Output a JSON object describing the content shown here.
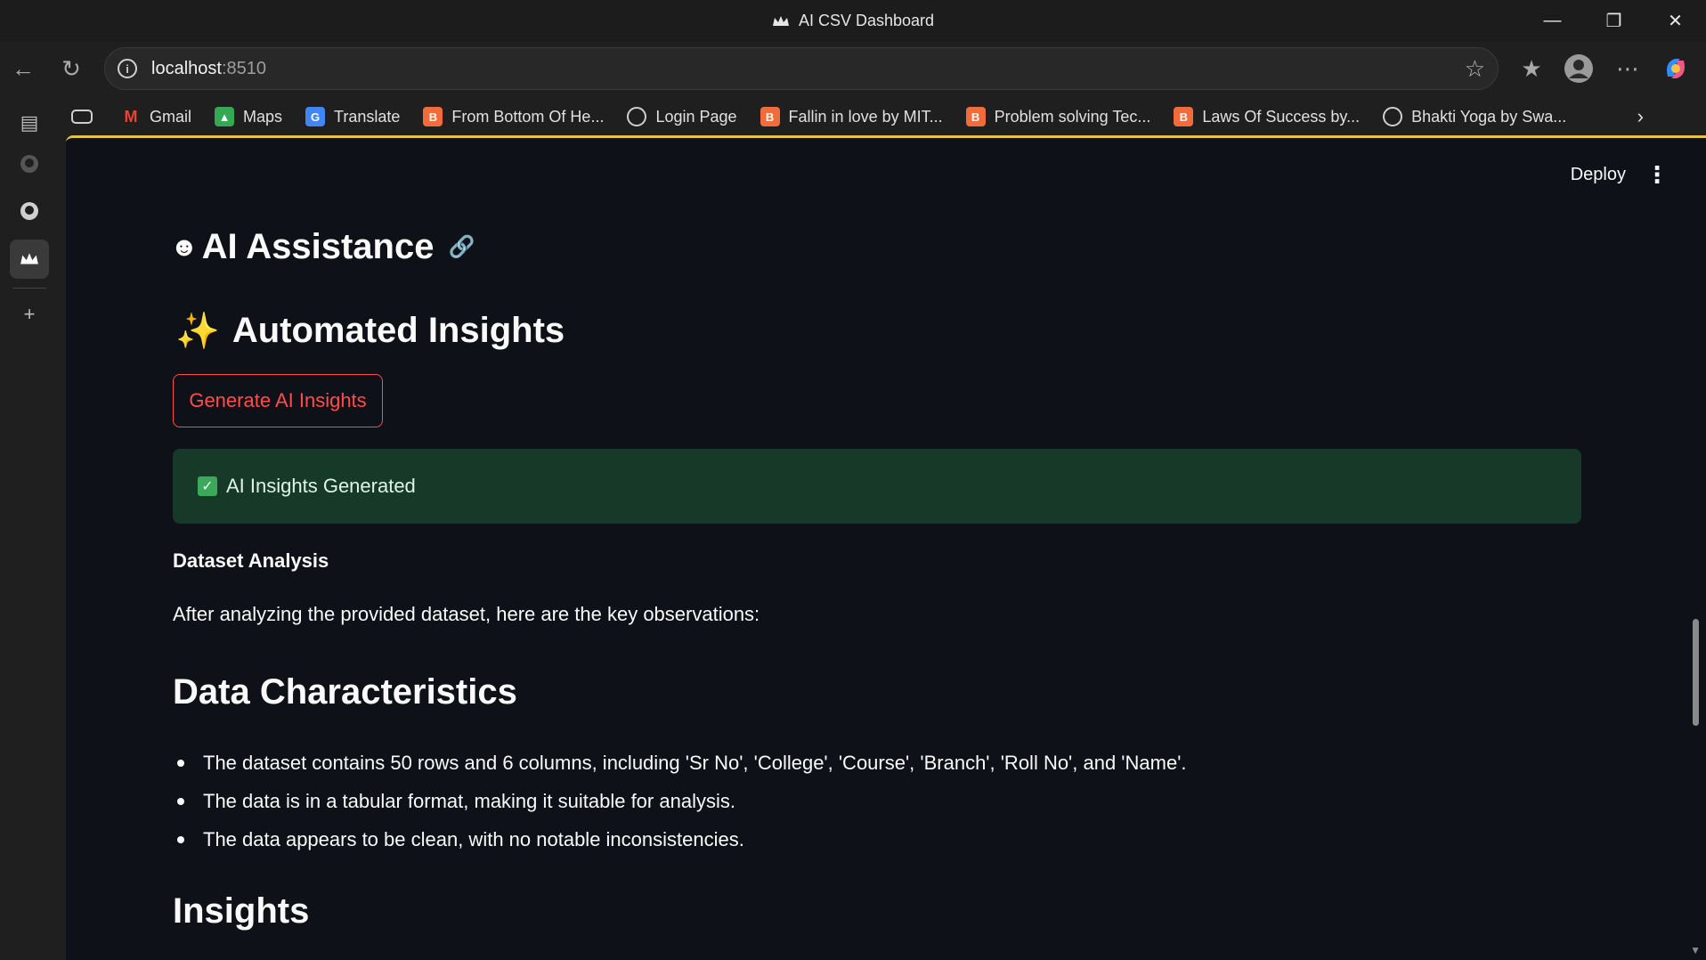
{
  "window": {
    "title": "AI CSV Dashboard",
    "controls": [
      "minimize",
      "restore",
      "close"
    ]
  },
  "browser": {
    "url_host": "localhost",
    "url_port": ":8510",
    "bookmarks": [
      {
        "label": "Gmail",
        "icon": "gmail-icon"
      },
      {
        "label": "Maps",
        "icon": "maps-icon"
      },
      {
        "label": "Translate",
        "icon": "translate-icon"
      },
      {
        "label": "From Bottom Of He...",
        "icon": "blog-icon"
      },
      {
        "label": "Login Page",
        "icon": "globe-icon"
      },
      {
        "label": "Fallin in love by MIT...",
        "icon": "blog-icon"
      },
      {
        "label": "Problem solving Tec...",
        "icon": "blog-icon"
      },
      {
        "label": "Laws Of Success by...",
        "icon": "blog-icon"
      },
      {
        "label": "Bhakti Yoga by Swa...",
        "icon": "globe-icon"
      }
    ]
  },
  "app": {
    "deploy_label": "Deploy",
    "assistance_heading": "AI Assistance",
    "automated_heading": "Automated Insights",
    "generate_button": "Generate AI Insights",
    "success_message": "AI Insights Generated",
    "dataset_analysis_title": "Dataset Analysis",
    "intro_text": "After analyzing the provided dataset, here are the key observations:",
    "data_characteristics_heading": "Data Characteristics",
    "data_characteristics": [
      "The dataset contains 50 rows and 6 columns, including 'Sr No', 'College', 'Course', 'Branch', 'Roll No', and 'Name'.",
      "The data is in a tabular format, making it suitable for analysis.",
      "The data appears to be clean, with no notable inconsistencies."
    ],
    "insights_heading": "Insights"
  },
  "colors": {
    "app_background": "#0e1117",
    "accent_red": "#ff4b4b",
    "success_background": "#173928"
  }
}
